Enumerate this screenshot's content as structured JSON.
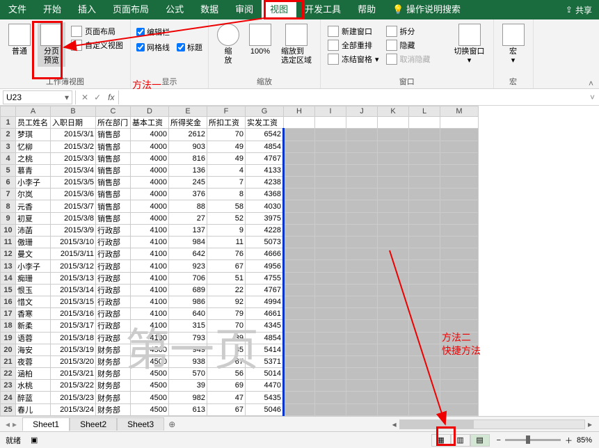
{
  "tabs": [
    "文件",
    "开始",
    "插入",
    "页面布局",
    "公式",
    "数据",
    "审阅",
    "视图",
    "开发工具",
    "帮助",
    "操作说明搜索"
  ],
  "active_tab": "视图",
  "share": "共享",
  "ribbon": {
    "group1": {
      "normal": "普通",
      "page_break": "分页\n预览",
      "layout": "页面布局",
      "custom": "自定义视图",
      "label": "工作簿视图"
    },
    "group2": {
      "formula_bar": "编辑栏",
      "gridlines": "网格线",
      "headings": "标题",
      "label": "显示"
    },
    "group3": {
      "zoom": "缩\n放",
      "hundred": "100%",
      "zoom_sel": "缩放到\n选定区域",
      "label": "缩放"
    },
    "group4": {
      "new_win": "新建窗口",
      "arrange": "全部重排",
      "freeze": "冻结窗格",
      "split": "拆分",
      "hide": "隐藏",
      "unhide": "取消隐藏",
      "switch": "切换窗口",
      "label": "窗口"
    },
    "group5": {
      "macro": "宏",
      "label": "宏"
    }
  },
  "annotations": {
    "m1": "方法一",
    "m2": "方法二",
    "m2b": "快捷方法"
  },
  "name_box": "U23",
  "watermark": "第一页",
  "chart_data": {
    "type": "table",
    "columns": [
      "员工姓名",
      "入职日期",
      "所在部门",
      "基本工资",
      "所得奖金",
      "所扣工资",
      "实发工资"
    ],
    "rows": [
      [
        "梦琪",
        "2015/3/1",
        "销售部",
        4000,
        2612,
        70,
        6542
      ],
      [
        "忆柳",
        "2015/3/2",
        "销售部",
        4000,
        903,
        49,
        4854
      ],
      [
        "之桃",
        "2015/3/3",
        "销售部",
        4000,
        816,
        49,
        4767
      ],
      [
        "慕青",
        "2015/3/4",
        "销售部",
        4000,
        136,
        4,
        4133
      ],
      [
        "小李子",
        "2015/3/5",
        "销售部",
        4000,
        245,
        7,
        4238
      ],
      [
        "尔岚",
        "2015/3/6",
        "销售部",
        4000,
        376,
        8,
        4368
      ],
      [
        "元香",
        "2015/3/7",
        "销售部",
        4000,
        88,
        58,
        4030
      ],
      [
        "初夏",
        "2015/3/8",
        "销售部",
        4000,
        27,
        52,
        3975
      ],
      [
        "沛菡",
        "2015/3/9",
        "行政部",
        4100,
        137,
        9,
        4228
      ],
      [
        "傲珊",
        "2015/3/10",
        "行政部",
        4100,
        984,
        11,
        5073
      ],
      [
        "曼文",
        "2015/3/11",
        "行政部",
        4100,
        642,
        76,
        4666
      ],
      [
        "小李子",
        "2015/3/12",
        "行政部",
        4100,
        923,
        67,
        4956
      ],
      [
        "痴珊",
        "2015/3/13",
        "行政部",
        4100,
        706,
        51,
        4755
      ],
      [
        "恨玉",
        "2015/3/14",
        "行政部",
        4100,
        689,
        22,
        4767
      ],
      [
        "惜文",
        "2015/3/15",
        "行政部",
        4100,
        986,
        92,
        4994
      ],
      [
        "香寒",
        "2015/3/16",
        "行政部",
        4100,
        640,
        79,
        4661
      ],
      [
        "新柔",
        "2015/3/17",
        "行政部",
        4100,
        315,
        70,
        4345
      ],
      [
        "语蓉",
        "2015/3/18",
        "行政部",
        4100,
        793,
        39,
        4854
      ],
      [
        "海安",
        "2015/3/19",
        "财务部",
        4500,
        949,
        35,
        5414
      ],
      [
        "夜蓉",
        "2015/3/20",
        "财务部",
        4500,
        938,
        67,
        5371
      ],
      [
        "涵柏",
        "2015/3/21",
        "财务部",
        4500,
        570,
        56,
        5014
      ],
      [
        "水桃",
        "2015/3/22",
        "财务部",
        4500,
        39,
        69,
        4470
      ],
      [
        "醉蓝",
        "2015/3/23",
        "财务部",
        4500,
        982,
        47,
        5435
      ],
      [
        "春儿",
        "2015/3/24",
        "财务部",
        4500,
        613,
        67,
        5046
      ]
    ]
  },
  "col_letters": [
    "A",
    "B",
    "C",
    "D",
    "E",
    "F",
    "G",
    "H",
    "I",
    "J",
    "K",
    "L",
    "M"
  ],
  "sheets": [
    "Sheet1",
    "Sheet2",
    "Sheet3"
  ],
  "active_sheet": "Sheet1",
  "status": "就绪",
  "zoom": "85%"
}
